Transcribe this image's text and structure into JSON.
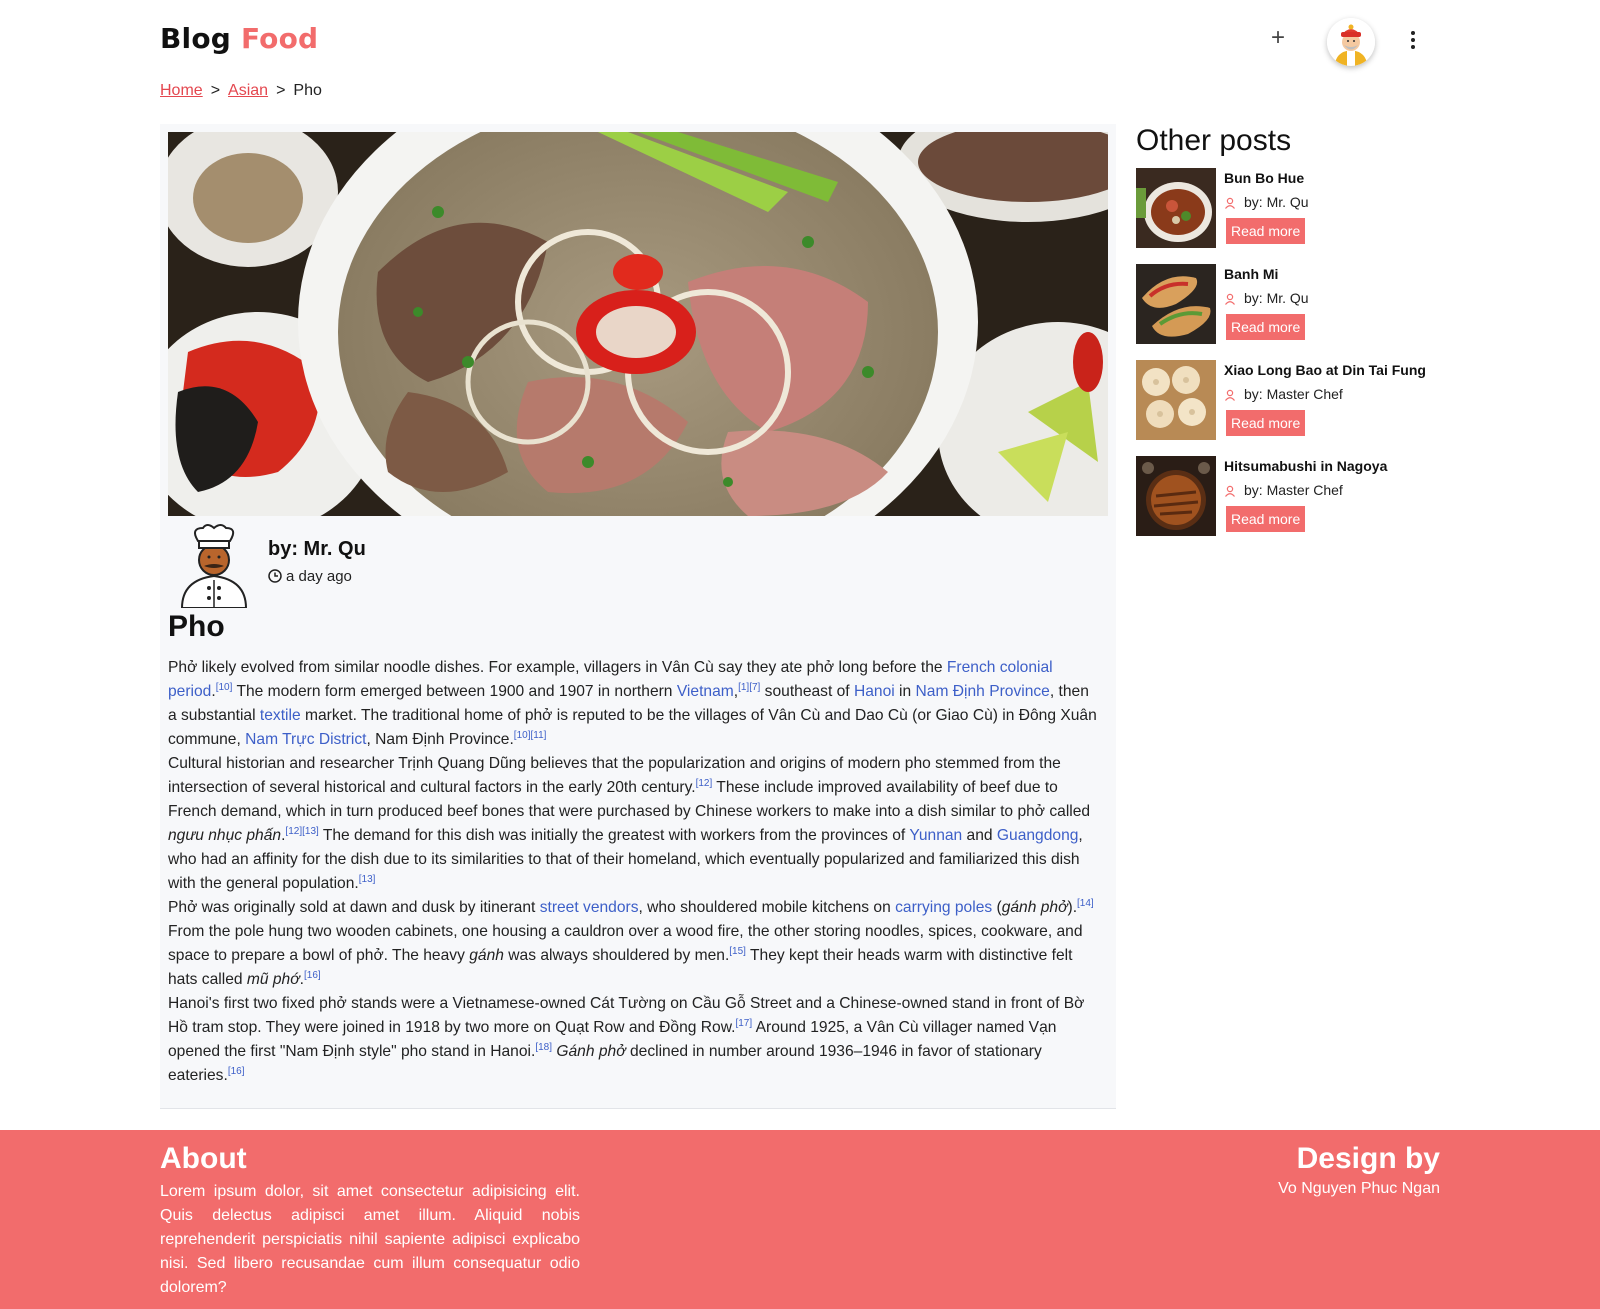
{
  "header": {
    "logo_blog": "Blog",
    "logo_food": "Food",
    "add_label": "+"
  },
  "breadcrumb": {
    "home": "Home",
    "sep1": ">",
    "category": "Asian",
    "sep2": ">",
    "current": "Pho"
  },
  "article": {
    "author": "by: Mr. Qu",
    "time": "a day ago",
    "title": "Pho",
    "p1": {
      "t1": "Phở likely evolved from similar noodle dishes. For example, villagers in Vân Cù say they ate phở long before the ",
      "l1": "French colonial period",
      "t2": ".",
      "r1": "[10]",
      "t3": " The modern form emerged between 1900 and 1907 in northern ",
      "l2": "Vietnam",
      "t4": ",",
      "r2": "[1][7]",
      "t5": " southeast of ",
      "l3": "Hanoi",
      "t6": " in ",
      "l4": "Nam Định Province",
      "t7": ", then a substantial ",
      "l5": "textile",
      "t8": " market. The traditional home of phở is reputed to be the villages of Vân Cù and Dao Cù (or Giao Cù) in Đông Xuân commune, ",
      "l6": "Nam Trực District",
      "t9": ", Nam Định Province.",
      "r3": "[10][11]"
    },
    "p2": {
      "t1": "Cultural historian and researcher Trịnh Quang Dũng believes that the popularization and origins of modern pho stemmed from the intersection of several historical and cultural factors in the early 20th century.",
      "r1": "[12]",
      "t2": " These include improved availability of beef due to French demand, which in turn produced beef bones that were purchased by Chinese workers to make into a dish similar to phở called ",
      "i1": "ngưu nhục phấn",
      "t3": ".",
      "r2": "[12][13]",
      "t4": " The demand for this dish was initially the greatest with workers from the provinces of ",
      "l1": "Yunnan",
      "t5": " and ",
      "l2": "Guangdong",
      "t6": ", who had an affinity for the dish due to its similarities to that of their homeland, which eventually popularized and familiarized this dish with the general population.",
      "r3": "[13]"
    },
    "p3": {
      "t1": "Phở was originally sold at dawn and dusk by itinerant ",
      "l1": "street vendors",
      "t2": ", who shouldered mobile kitchens on ",
      "l2": "carrying poles",
      "t3": " (",
      "i1": "gánh phở",
      "t4": ").",
      "r1": "[14]",
      "t5": " From the pole hung two wooden cabinets, one housing a cauldron over a wood fire, the other storing noodles, spices, cookware, and space to prepare a bowl of phở. The heavy ",
      "i2": "gánh",
      "t6": " was always shouldered by men.",
      "r2": "[15]",
      "t7": " They kept their heads warm with distinctive felt hats called ",
      "i3": "mũ phớ",
      "t8": ".",
      "r3": "[16]"
    },
    "p4": {
      "t1": "Hanoi's first two fixed phở stands were a Vietnamese-owned Cát Tường on Cầu Gỗ Street and a Chinese-owned stand in front of Bờ Hồ tram stop. They were joined in 1918 by two more on Quạt Row and Đồng Row.",
      "r1": "[17]",
      "t2": " Around 1925, a Vân Cù villager named Vạn opened the first \"Nam Định style\" pho stand in Hanoi.",
      "r2": "[18]",
      "t3": " ",
      "i1": "Gánh phở",
      "t4": " declined in number around 1936–1946 in favor of stationary eateries.",
      "r3": "[16]"
    }
  },
  "sidebar": {
    "title": "Other posts",
    "read_more": "Read more",
    "posts": [
      {
        "title": "Bun Bo Hue",
        "author": "by: Mr. Qu"
      },
      {
        "title": "Banh Mi",
        "author": "by: Mr. Qu"
      },
      {
        "title": "Xiao Long Bao at Din Tai Fung",
        "author": "by: Master Chef"
      },
      {
        "title": "Hitsumabushi in Nagoya",
        "author": "by: Master Chef"
      }
    ]
  },
  "footer": {
    "about_title": "About",
    "about_text": "Lorem ipsum dolor, sit amet consectetur adipisicing elit. Quis delectus adipisci amet illum. Aliquid nobis reprehenderit perspiciatis nihil sapiente adipisci explicabo nisi. Sed libero recusandae cum illum consequatur odio dolorem?",
    "design_title": "Design by",
    "design_name": "Vo Nguyen Phuc Ngan"
  },
  "colors": {
    "accent": "#f26c6c",
    "link": "#3d5fc8",
    "breadcrumb_link": "#e4474f"
  },
  "icons": [
    "plus-icon",
    "user-avatar",
    "more-vert-icon",
    "chef-avatar",
    "clock-icon",
    "user-icon"
  ]
}
